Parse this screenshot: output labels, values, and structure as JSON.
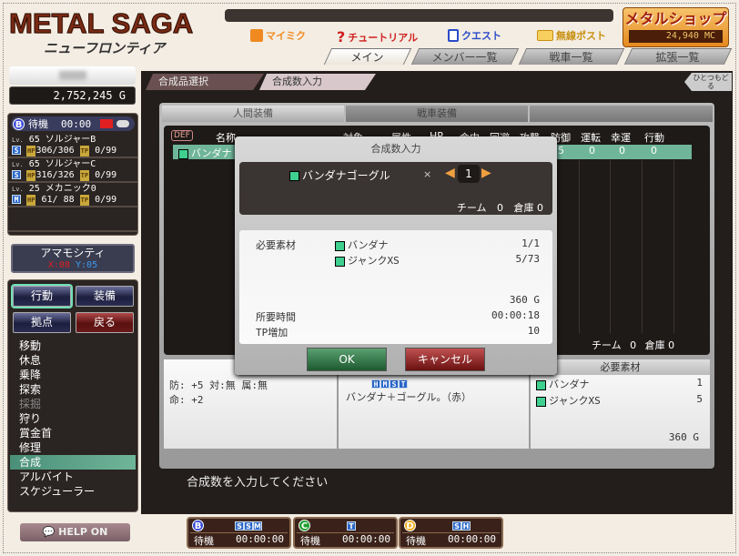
{
  "header": {
    "logo_title": "METAL SAGA",
    "logo_subtitle": "ニューフロンティア",
    "links": [
      {
        "label": "マイミク",
        "icon": "person-icon",
        "color": "#f08a20"
      },
      {
        "label": "チュートリアル",
        "icon": "question-icon",
        "color": "#d02020"
      },
      {
        "label": "クエスト",
        "icon": "document-icon",
        "color": "#2a4ac8"
      },
      {
        "label": "無線ポスト",
        "icon": "mail-icon",
        "color": "#e8a820"
      }
    ],
    "shop": {
      "label": "メタルショップ",
      "balance": "24,940 MC"
    },
    "tabs": [
      {
        "label": "メイン",
        "active": true
      },
      {
        "label": "メンバー一覧"
      },
      {
        "label": "戦車一覧"
      },
      {
        "label": "拡張一覧"
      }
    ]
  },
  "player": {
    "gold": "2,752,245 G"
  },
  "party": {
    "team": "B",
    "status": "待機",
    "time": "00:00",
    "members": [
      {
        "lv": "65",
        "name": "ソルジャーB",
        "cls": "S",
        "hp": "306/306",
        "tp": "0/99"
      },
      {
        "lv": "65",
        "name": "ソルジャーC",
        "cls": "S",
        "hp": "316/326",
        "tp": "0/99"
      },
      {
        "lv": "25",
        "name": "メカニック0",
        "cls": "M",
        "hp": " 61/ 88",
        "tp": "0/99"
      }
    ],
    "lv_label": "Lv.",
    "hp_label": "HP",
    "tp_label": "TP"
  },
  "town": {
    "name": "アマモシティ",
    "x": "X:08",
    "y": "Y:05"
  },
  "commands": {
    "buttons": [
      "行動",
      "装備",
      "拠点",
      "戻る"
    ],
    "menu": [
      "移動",
      "休息",
      "乗降",
      "探索",
      "採掘",
      "狩り",
      "賞金首",
      "修理",
      "合成",
      "アルバイト",
      "スケジューラー"
    ],
    "selected": "合成",
    "disabled": "採掘"
  },
  "help": "HELP ON",
  "breadcrumb": [
    "合成品選択",
    "合成数入力"
  ],
  "back": "ひとつもどる",
  "inner_tabs": [
    "人間装備",
    "戦車装備",
    ""
  ],
  "table": {
    "def": "DEF",
    "headers": [
      "名称",
      "対象",
      "属性",
      "HP",
      "命中",
      "回避",
      "攻撃",
      "防御",
      "運転",
      "幸運",
      "行動"
    ],
    "row": {
      "name": "バンダナ",
      "tail": [
        "5",
        "0",
        "0",
        "0"
      ]
    },
    "footer": {
      "team_label": "チーム",
      "team": "0",
      "storage_label": "倉庫",
      "storage": "0"
    }
  },
  "detail": {
    "stats": [
      "防: +5  対:無  属:無",
      "命: +2"
    ],
    "usable": [
      "H",
      "M",
      "S",
      "T"
    ],
    "description": "バンダナ＋ゴーグル。（赤）",
    "materials_header": "必要素材",
    "materials": [
      {
        "name": "バンダナ",
        "qty": "1"
      },
      {
        "name": "ジャンクXS",
        "qty": "5"
      }
    ],
    "cost": "360 G"
  },
  "message": "合成数を入力してください",
  "slots": [
    {
      "team": "B",
      "color": "#3a4ad8",
      "classes": [
        "S",
        "S",
        "M"
      ],
      "status": "待機",
      "time": "00:00:00"
    },
    {
      "team": "C",
      "color": "#20a030",
      "classes": [
        "T"
      ],
      "status": "待機",
      "time": "00:00:00"
    },
    {
      "team": "D",
      "color": "#f0b020",
      "classes": [
        "S",
        "H"
      ],
      "status": "待機",
      "time": "00:00:00"
    }
  ],
  "dialog": {
    "title": "合成数入力",
    "item": "バンダナゴーグル",
    "times": "×",
    "quantity": "1",
    "team_label": "チーム",
    "team": "0",
    "storage_label": "倉庫",
    "storage": "0",
    "materials_label": "必要素材",
    "materials": [
      {
        "name": "バンダナ",
        "have": "1/1"
      },
      {
        "name": "ジャンクXS",
        "have": "5/73"
      }
    ],
    "cost": "360 G",
    "time_label": "所要時間",
    "time": "00:00:18",
    "tp_label": "TP増加",
    "tp": "10",
    "ok": "OK",
    "cancel": "キャンセル"
  }
}
